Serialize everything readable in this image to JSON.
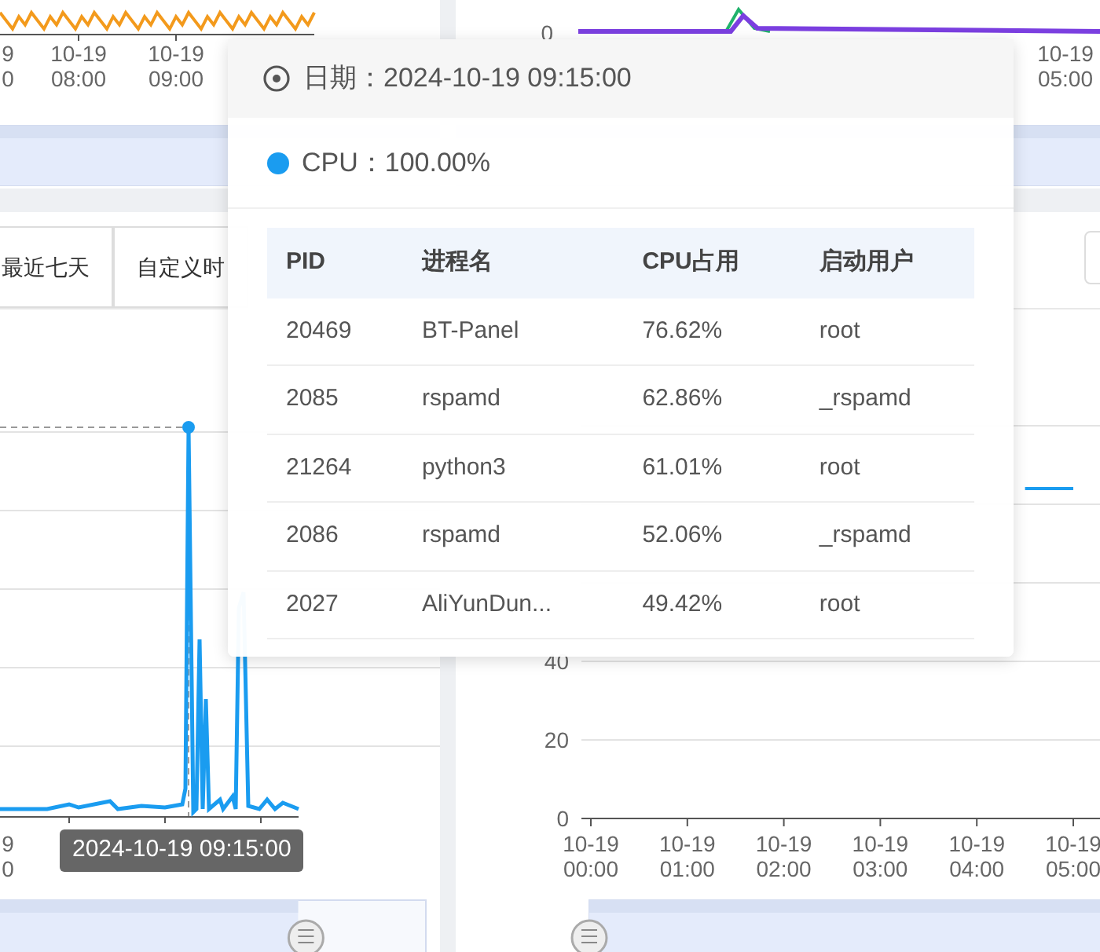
{
  "top_left_chart": {
    "x_labels": [
      "9 0",
      "10-19 08:00",
      "10-19 09:00"
    ],
    "zoom_slider": {
      "level": 1
    }
  },
  "top_right_chart": {
    "y_labels": [
      "0"
    ],
    "x_labels": [
      "10-19 05:00"
    ],
    "zoom_slider": {
      "level": 1
    }
  },
  "range_buttons": [
    {
      "label": "最近七天"
    },
    {
      "label": "自定义时"
    }
  ],
  "cpu_chart": {
    "x_labels": [
      "9 0"
    ],
    "hover_time": "2024-10-19 09:15:00",
    "zoom_slider": {
      "level": 0.7
    }
  },
  "percent_chart": {
    "zoom_slider": {
      "level": 1
    },
    "chart_data": {
      "type": "line",
      "categories": [
        "10-19 00:00",
        null,
        "10-19 01:00",
        null,
        "10-19 02:00",
        null,
        "10-19 03:00",
        null,
        "10-19 04:00",
        null,
        "10-19 05:00"
      ],
      "ylim": [
        0,
        100
      ],
      "yticks": [
        0,
        20,
        40
      ],
      "series": [
        {
          "values": [
            null,
            null,
            null,
            null,
            null,
            null,
            null,
            null,
            null,
            84,
            84
          ]
        }
      ]
    }
  },
  "tooltip": {
    "date": "日期：2024-10-19 09:15:00",
    "series": [
      {
        "label": "CPU：100.00%"
      }
    ],
    "table": {
      "columns": [
        "PID",
        "进程名",
        "CPU占用",
        "启动用户"
      ],
      "rows": [
        [
          "20469",
          "BT-Panel",
          "76.62%",
          "root"
        ],
        [
          "2085",
          "rspamd",
          "62.86%",
          "_rspamd"
        ],
        [
          "21264",
          "python3",
          "61.01%",
          "root"
        ],
        [
          "2086",
          "rspamd",
          "52.06%",
          "_rspamd"
        ],
        [
          "2027",
          "AliYunDun...",
          "49.42%",
          "root"
        ]
      ]
    }
  }
}
